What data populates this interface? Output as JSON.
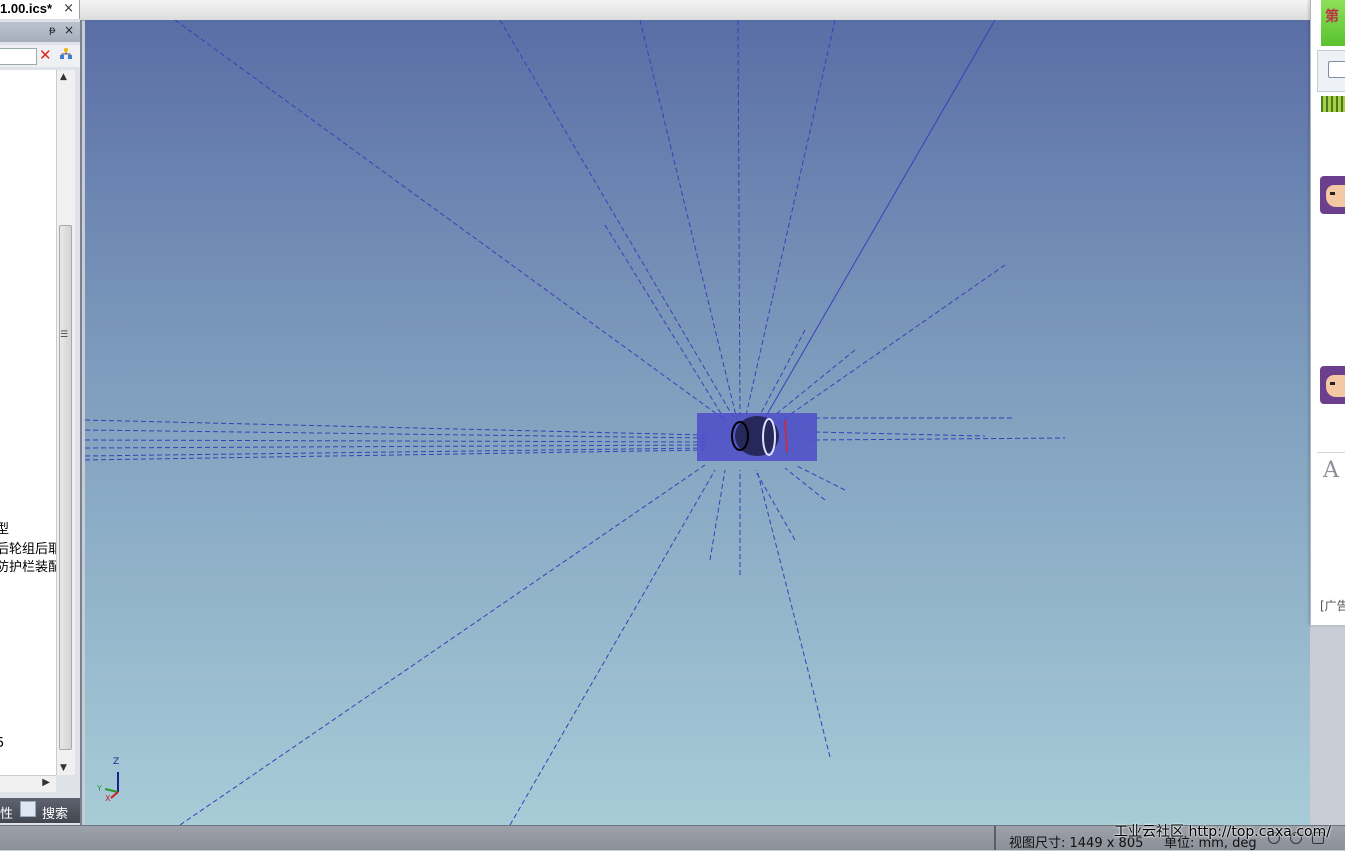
{
  "document_tab": {
    "title": "1.00.ics*",
    "close": "×"
  },
  "left_panel": {
    "pin": "ᵽ",
    "close": "×",
    "toolbar": {
      "clear_icon": "x-icon",
      "tree_icon": "tree-icon"
    },
    "tree_items": [
      "型",
      "后轮组后耶",
      "防护栏装配",
      "5"
    ],
    "tabs": {
      "tab1_label": "性",
      "tab2_icon": "search-icon",
      "tab2_label": "搜索"
    }
  },
  "viewport": {
    "triad": {
      "z": "Z",
      "y": "Y",
      "x": "X"
    },
    "line_color": "#3a3fb8"
  },
  "side_panel": {
    "top_glyph": "第",
    "letter": "A",
    "ad_label": "[广告"
  },
  "status_bar": {
    "view_size": "视图尺寸: 1449 x  805",
    "units": "单位: mm, deg"
  },
  "watermark": "工业云社区 http://top.caxa.com/"
}
